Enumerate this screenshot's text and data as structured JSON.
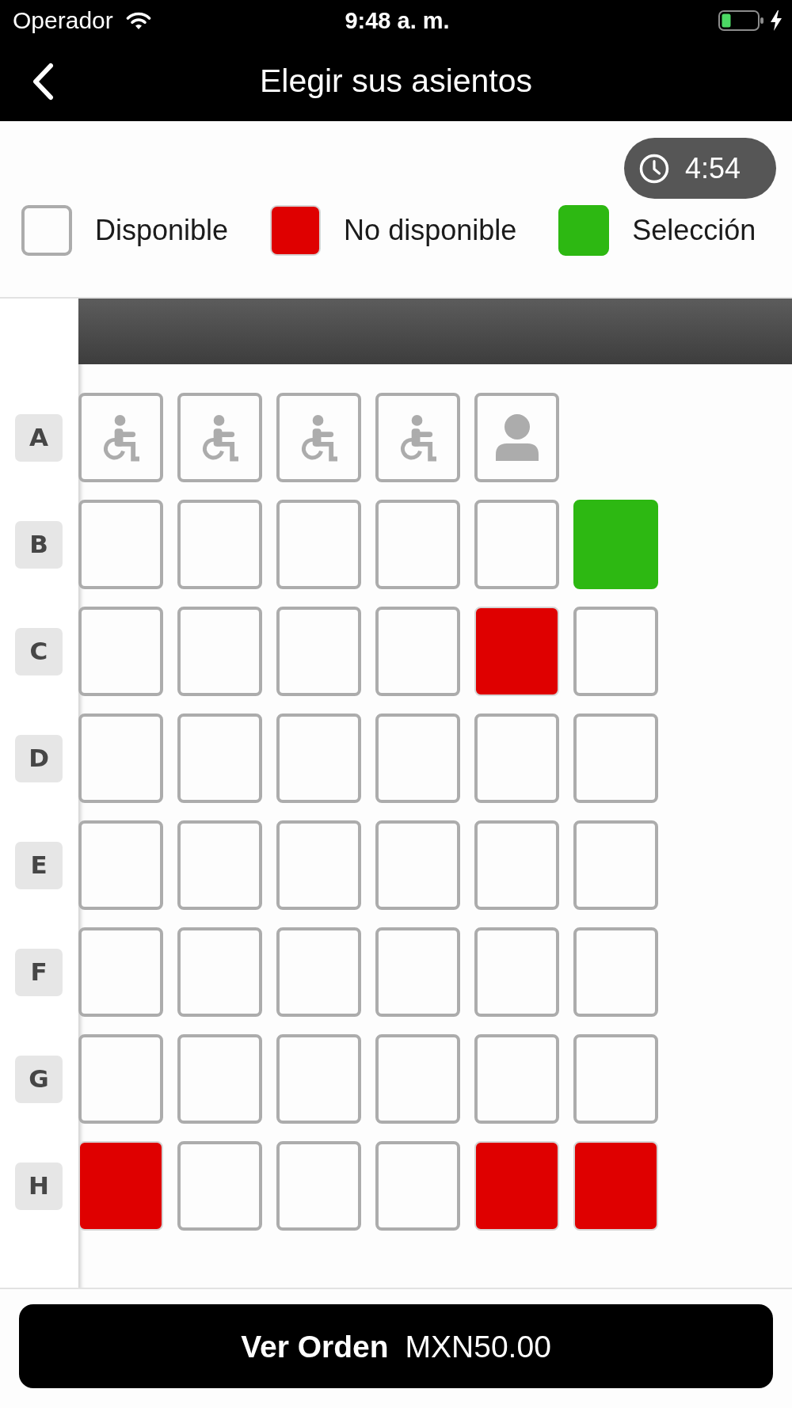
{
  "status_bar": {
    "carrier": "Operador",
    "time": "9:48 a. m."
  },
  "nav": {
    "title": "Elegir sus asientos"
  },
  "timer": {
    "remaining": "4:54"
  },
  "legend": [
    {
      "kind": "available",
      "label": "Disponible"
    },
    {
      "kind": "unavailable",
      "label": "No disponible"
    },
    {
      "kind": "selected",
      "label": "Selección"
    }
  ],
  "seat_rows": [
    {
      "row": "A",
      "seats": [
        {
          "kind": "wheelchair",
          "available": true,
          "selected": false
        },
        {
          "kind": "wheelchair",
          "available": true,
          "selected": false
        },
        {
          "kind": "wheelchair",
          "available": true,
          "selected": false
        },
        {
          "kind": "wheelchair",
          "available": true,
          "selected": false
        },
        {
          "kind": "companion",
          "available": true,
          "selected": false
        }
      ]
    },
    {
      "row": "B",
      "seats": [
        {
          "kind": "standard",
          "available": true,
          "selected": false
        },
        {
          "kind": "standard",
          "available": true,
          "selected": false
        },
        {
          "kind": "standard",
          "available": true,
          "selected": false
        },
        {
          "kind": "standard",
          "available": true,
          "selected": false
        },
        {
          "kind": "standard",
          "available": true,
          "selected": false
        },
        {
          "kind": "standard",
          "available": true,
          "selected": true
        }
      ]
    },
    {
      "row": "C",
      "seats": [
        {
          "kind": "standard",
          "available": true,
          "selected": false
        },
        {
          "kind": "standard",
          "available": true,
          "selected": false
        },
        {
          "kind": "standard",
          "available": true,
          "selected": false
        },
        {
          "kind": "standard",
          "available": true,
          "selected": false
        },
        {
          "kind": "standard",
          "available": false,
          "selected": false
        },
        {
          "kind": "standard",
          "available": true,
          "selected": false
        }
      ]
    },
    {
      "row": "D",
      "seats": [
        {
          "kind": "standard",
          "available": true,
          "selected": false
        },
        {
          "kind": "standard",
          "available": true,
          "selected": false
        },
        {
          "kind": "standard",
          "available": true,
          "selected": false
        },
        {
          "kind": "standard",
          "available": true,
          "selected": false
        },
        {
          "kind": "standard",
          "available": true,
          "selected": false
        },
        {
          "kind": "standard",
          "available": true,
          "selected": false
        }
      ]
    },
    {
      "row": "E",
      "seats": [
        {
          "kind": "standard",
          "available": true,
          "selected": false
        },
        {
          "kind": "standard",
          "available": true,
          "selected": false
        },
        {
          "kind": "standard",
          "available": true,
          "selected": false
        },
        {
          "kind": "standard",
          "available": true,
          "selected": false
        },
        {
          "kind": "standard",
          "available": true,
          "selected": false
        },
        {
          "kind": "standard",
          "available": true,
          "selected": false
        }
      ]
    },
    {
      "row": "F",
      "seats": [
        {
          "kind": "standard",
          "available": true,
          "selected": false
        },
        {
          "kind": "standard",
          "available": true,
          "selected": false
        },
        {
          "kind": "standard",
          "available": true,
          "selected": false
        },
        {
          "kind": "standard",
          "available": true,
          "selected": false
        },
        {
          "kind": "standard",
          "available": true,
          "selected": false
        },
        {
          "kind": "standard",
          "available": true,
          "selected": false
        }
      ]
    },
    {
      "row": "G",
      "seats": [
        {
          "kind": "standard",
          "available": true,
          "selected": false
        },
        {
          "kind": "standard",
          "available": true,
          "selected": false
        },
        {
          "kind": "standard",
          "available": true,
          "selected": false
        },
        {
          "kind": "standard",
          "available": true,
          "selected": false
        },
        {
          "kind": "standard",
          "available": true,
          "selected": false
        },
        {
          "kind": "standard",
          "available": true,
          "selected": false
        }
      ]
    },
    {
      "row": "H",
      "seats": [
        {
          "kind": "standard",
          "available": false,
          "selected": false
        },
        {
          "kind": "standard",
          "available": true,
          "selected": false
        },
        {
          "kind": "standard",
          "available": true,
          "selected": false
        },
        {
          "kind": "standard",
          "available": true,
          "selected": false
        },
        {
          "kind": "standard",
          "available": false,
          "selected": false
        },
        {
          "kind": "standard",
          "available": false,
          "selected": false
        }
      ]
    }
  ],
  "order_button": {
    "label": "Ver Orden",
    "total": "MXN50.00"
  }
}
